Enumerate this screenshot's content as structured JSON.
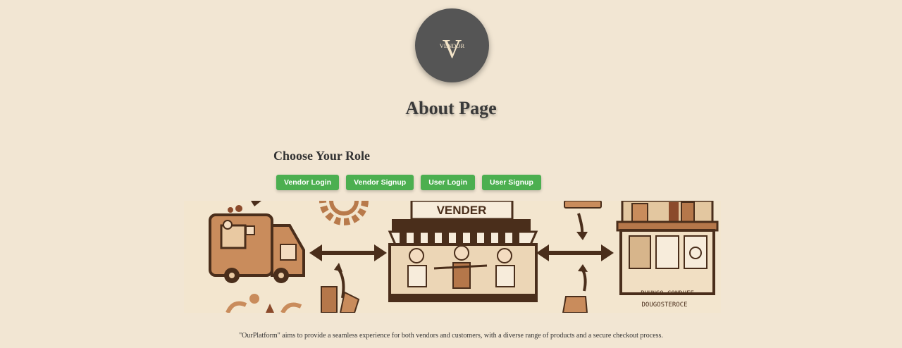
{
  "logo": {
    "letter": "V",
    "word": "VENDOR"
  },
  "page": {
    "title": "About Page"
  },
  "roles": {
    "heading": "Choose Your Role",
    "buttons": {
      "vendor_login": "Vendor Login",
      "vendor_signup": "Vendor Signup",
      "user_login": "User Login",
      "user_signup": "User Signup"
    },
    "button_color": "#4caf50"
  },
  "hero": {
    "sign_text": "VENDER",
    "awning_text": "VENDER",
    "shelf_text_1": "BUUNGO CONDUEE",
    "shelf_text_2": "DOUGOSTEROCE"
  },
  "caption": "\"OurPlatform\" aims to provide a seamless experience for both vendors and customers, with a diverse range of products and a secure checkout process."
}
